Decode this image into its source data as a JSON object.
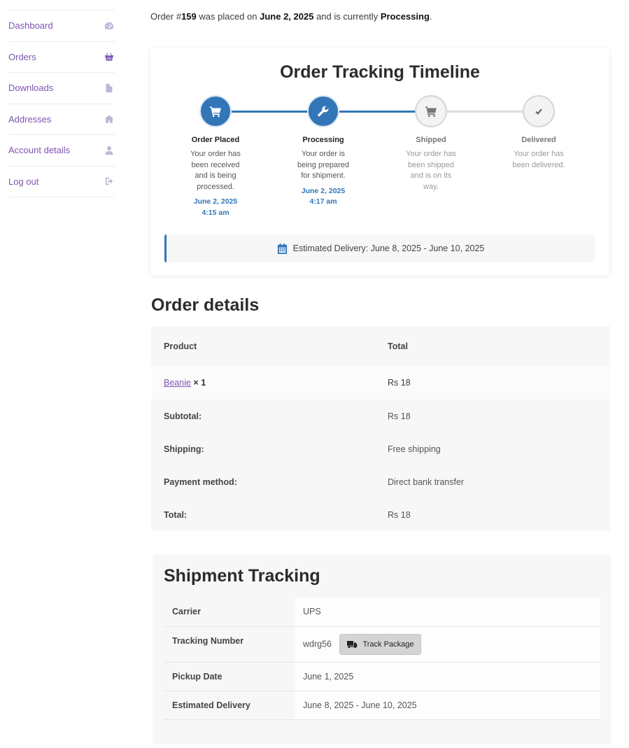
{
  "sidebar": {
    "items": [
      {
        "label": "Dashboard",
        "icon": "dashboard-icon"
      },
      {
        "label": "Orders",
        "icon": "basket-icon"
      },
      {
        "label": "Downloads",
        "icon": "file-icon"
      },
      {
        "label": "Addresses",
        "icon": "home-icon"
      },
      {
        "label": "Account details",
        "icon": "user-icon"
      },
      {
        "label": "Log out",
        "icon": "logout-icon"
      }
    ]
  },
  "intro": {
    "prefix": "Order #",
    "order_number": "159",
    "placed_text": " was placed on ",
    "date": "June 2, 2025",
    "status_text": " and is currently ",
    "status": "Processing",
    "suffix": "."
  },
  "timeline": {
    "title": "Order Tracking Timeline",
    "steps": [
      {
        "label": "Order Placed",
        "desc": "Your order has been received and is being processed.",
        "date": "June 2, 2025 4:15 am",
        "state": "done",
        "icon": "cart-icon"
      },
      {
        "label": "Processing",
        "desc": "Your order is being prepared for shipment.",
        "date": "June 2, 2025 4:17 am",
        "state": "done",
        "icon": "wrench-icon"
      },
      {
        "label": "Shipped",
        "desc": "Your order has been shipped and is on its way.",
        "date": "",
        "state": "pending",
        "icon": "cart-icon"
      },
      {
        "label": "Delivered",
        "desc": "Your order has been delivered.",
        "date": "",
        "state": "pending",
        "icon": "check-icon"
      }
    ],
    "estimated_delivery": "Estimated Delivery: June 8, 2025 - June 10, 2025"
  },
  "order_details": {
    "title": "Order details",
    "headers": {
      "product": "Product",
      "total": "Total"
    },
    "item": {
      "name": "Beanie",
      "qty": "× 1",
      "total": "Rs 18"
    },
    "totals": [
      {
        "label": "Subtotal:",
        "value": "Rs 18"
      },
      {
        "label": "Shipping:",
        "value": "Free shipping"
      },
      {
        "label": "Payment method:",
        "value": "Direct bank transfer"
      },
      {
        "label": "Total:",
        "value": "Rs 18"
      }
    ]
  },
  "shipment": {
    "title": "Shipment Tracking",
    "carrier_label": "Carrier",
    "carrier": "UPS",
    "tracking_label": "Tracking Number",
    "tracking_number": "wdrg56",
    "track_button": "Track Package",
    "pickup_label": "Pickup Date",
    "pickup_date": "June 1, 2025",
    "estimated_label": "Estimated Delivery",
    "estimated": "June 8, 2025 - June 10, 2025"
  },
  "colors": {
    "accent": "#7f54b3",
    "timeline_blue": "#3276b8",
    "panel_bg": "#f7f7f7"
  }
}
